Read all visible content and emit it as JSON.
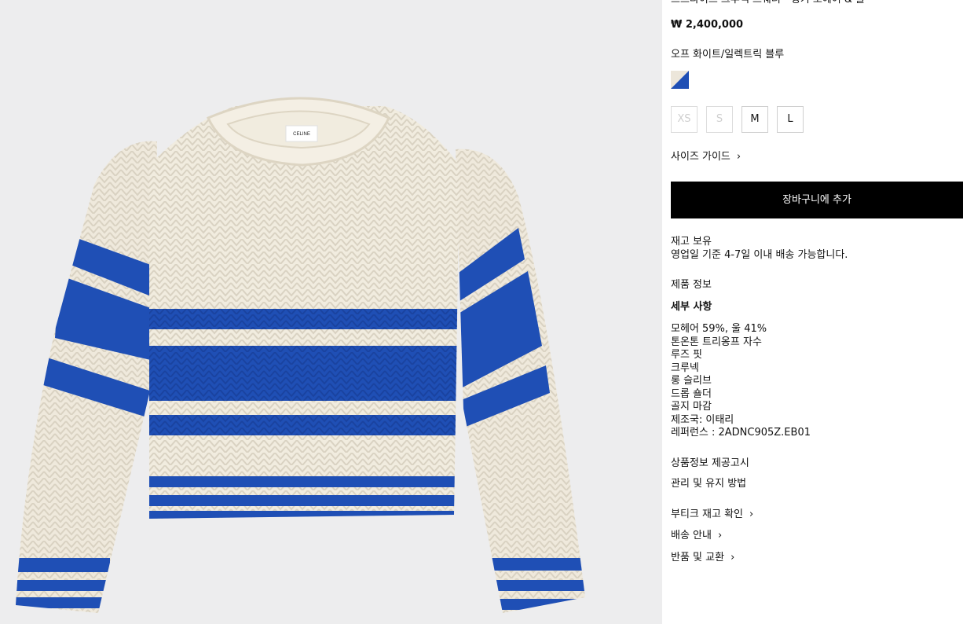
{
  "product": {
    "title": "스트라이프 크루넥 스웨터 - 청키 모헤어 & 울",
    "price": "₩ 2,400,000",
    "color_name": "오프 화이트/일렉트릭 블루",
    "colors": {
      "off_white": "#ece6da",
      "electric_blue": "#1f4fb5"
    },
    "image_label": "CELINE"
  },
  "sizes": [
    {
      "label": "XS",
      "available": false
    },
    {
      "label": "S",
      "available": false
    },
    {
      "label": "M",
      "available": true
    },
    {
      "label": "L",
      "available": true
    }
  ],
  "size_guide": "사이즈 가이드",
  "add_to_cart": "장바구니에 추가",
  "stock": {
    "status": "재고 보유",
    "shipping_note": "영업일 기준 4-7일 이내 배송 가능합니다."
  },
  "product_info_label": "제품 정보",
  "details": {
    "heading": "세부 사항",
    "items": [
      "모헤어 59%, 울 41%",
      "톤온톤 트리옹프 자수",
      "루즈 핏",
      "크루넥",
      "롱 슬리브",
      "드롭 숄더",
      "골지 마감",
      "제조국: 이태리",
      "레퍼런스 : 2ADNC905Z.EB01"
    ]
  },
  "notice_label": "상품정보 제공고시",
  "care_label": "관리 및 유지 방법",
  "links": {
    "stock_check": "부티크 재고 확인",
    "delivery": "배송 안내",
    "returns": "반품 및 교환"
  },
  "icons": {
    "chevron": "chevron-right-icon"
  }
}
